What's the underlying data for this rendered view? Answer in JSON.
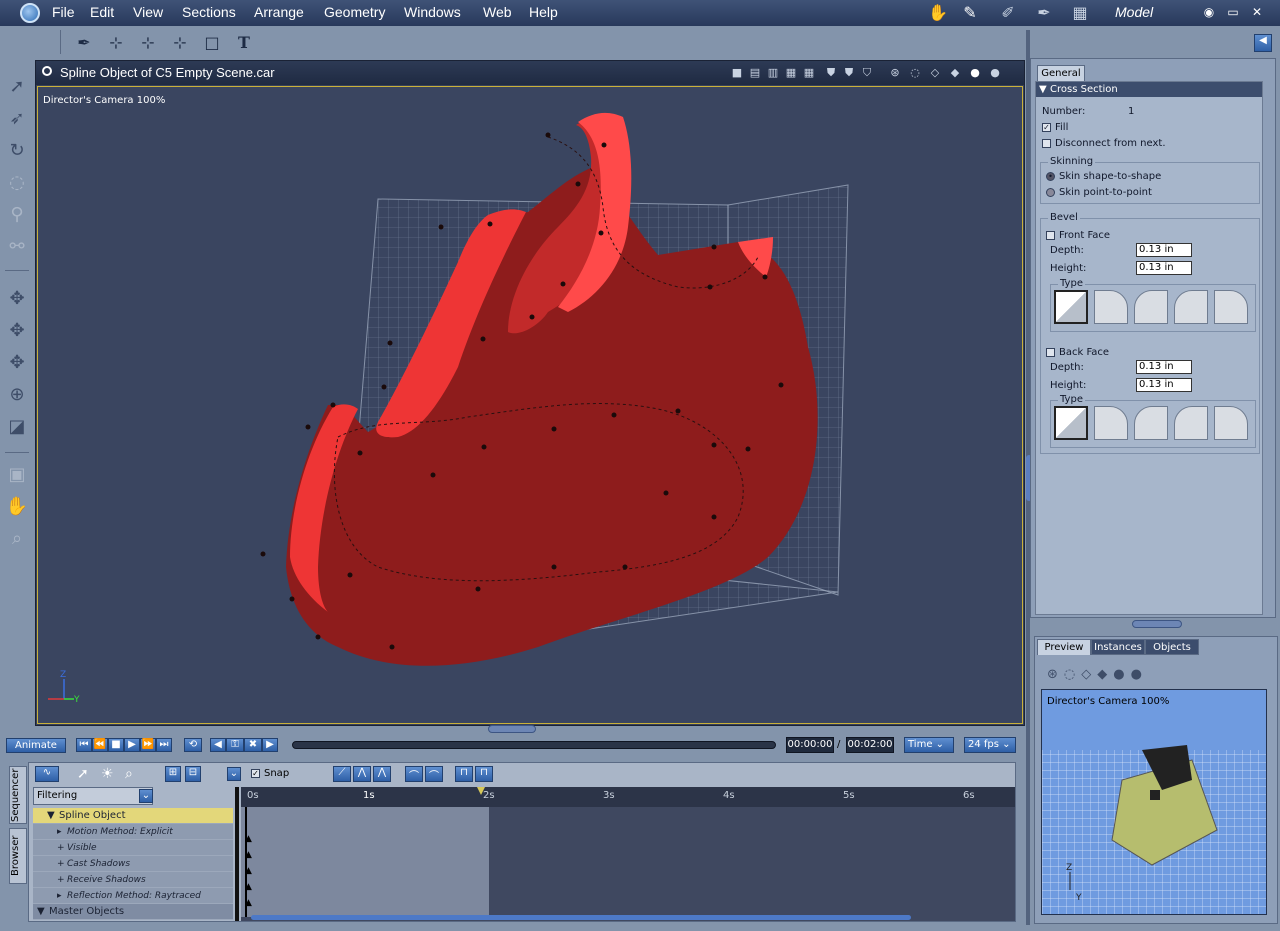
{
  "menu": {
    "items": [
      "File",
      "Edit",
      "View",
      "Sections",
      "Arrange",
      "Geometry",
      "Windows",
      "Web",
      "Help"
    ],
    "room": "Model"
  },
  "document": {
    "title": "Spline Object of C5 Empty Scene.car",
    "camera_label": "Director's Camera 100%"
  },
  "animation": {
    "animate_label": "Animate",
    "current_time": "00:00:00",
    "separator": "/",
    "end_time": "00:02:00",
    "time_mode": "Time",
    "fps": "24 fps"
  },
  "sequencer": {
    "tabs": [
      "Sequencer",
      "Browser"
    ],
    "snap_label": "Snap",
    "filter_label": "Filtering",
    "ruler_ticks": [
      "0s",
      "1s",
      "2s",
      "3s",
      "4s",
      "5s",
      "6s"
    ],
    "tree": [
      {
        "label": "Spline Object",
        "selected": true
      },
      {
        "label": "Motion Method: Explicit"
      },
      {
        "label": "Visible"
      },
      {
        "label": "Cast Shadows"
      },
      {
        "label": "Receive Shadows"
      },
      {
        "label": "Reflection Method: Raytraced"
      },
      {
        "label": "Master Objects"
      }
    ]
  },
  "properties": {
    "tab": "General",
    "section": "Cross Section",
    "number_label": "Number:",
    "number_value": "1",
    "fill_label": "Fill",
    "fill_checked": true,
    "disconnect_label": "Disconnect from next.",
    "skinning_label": "Skinning",
    "skin_options": [
      "Skin shape-to-shape",
      "Skin point-to-point"
    ],
    "bevel_label": "Bevel",
    "front_face_label": "Front Face",
    "back_face_label": "Back Face",
    "depth_label": "Depth:",
    "height_label": "Height:",
    "front_depth": "0.13 in",
    "front_height": "0.13 in",
    "back_depth": "0.13 in",
    "back_height": "0.13 in",
    "type_label": "Type"
  },
  "preview": {
    "tabs": [
      "Preview",
      "Instances",
      "Objects"
    ],
    "camera_label": "Director's Camera 100%"
  },
  "colors": {
    "object_red": "#a31f1f",
    "highlight_red": "#ee3535",
    "selection_yellow": "#e3d77a"
  }
}
